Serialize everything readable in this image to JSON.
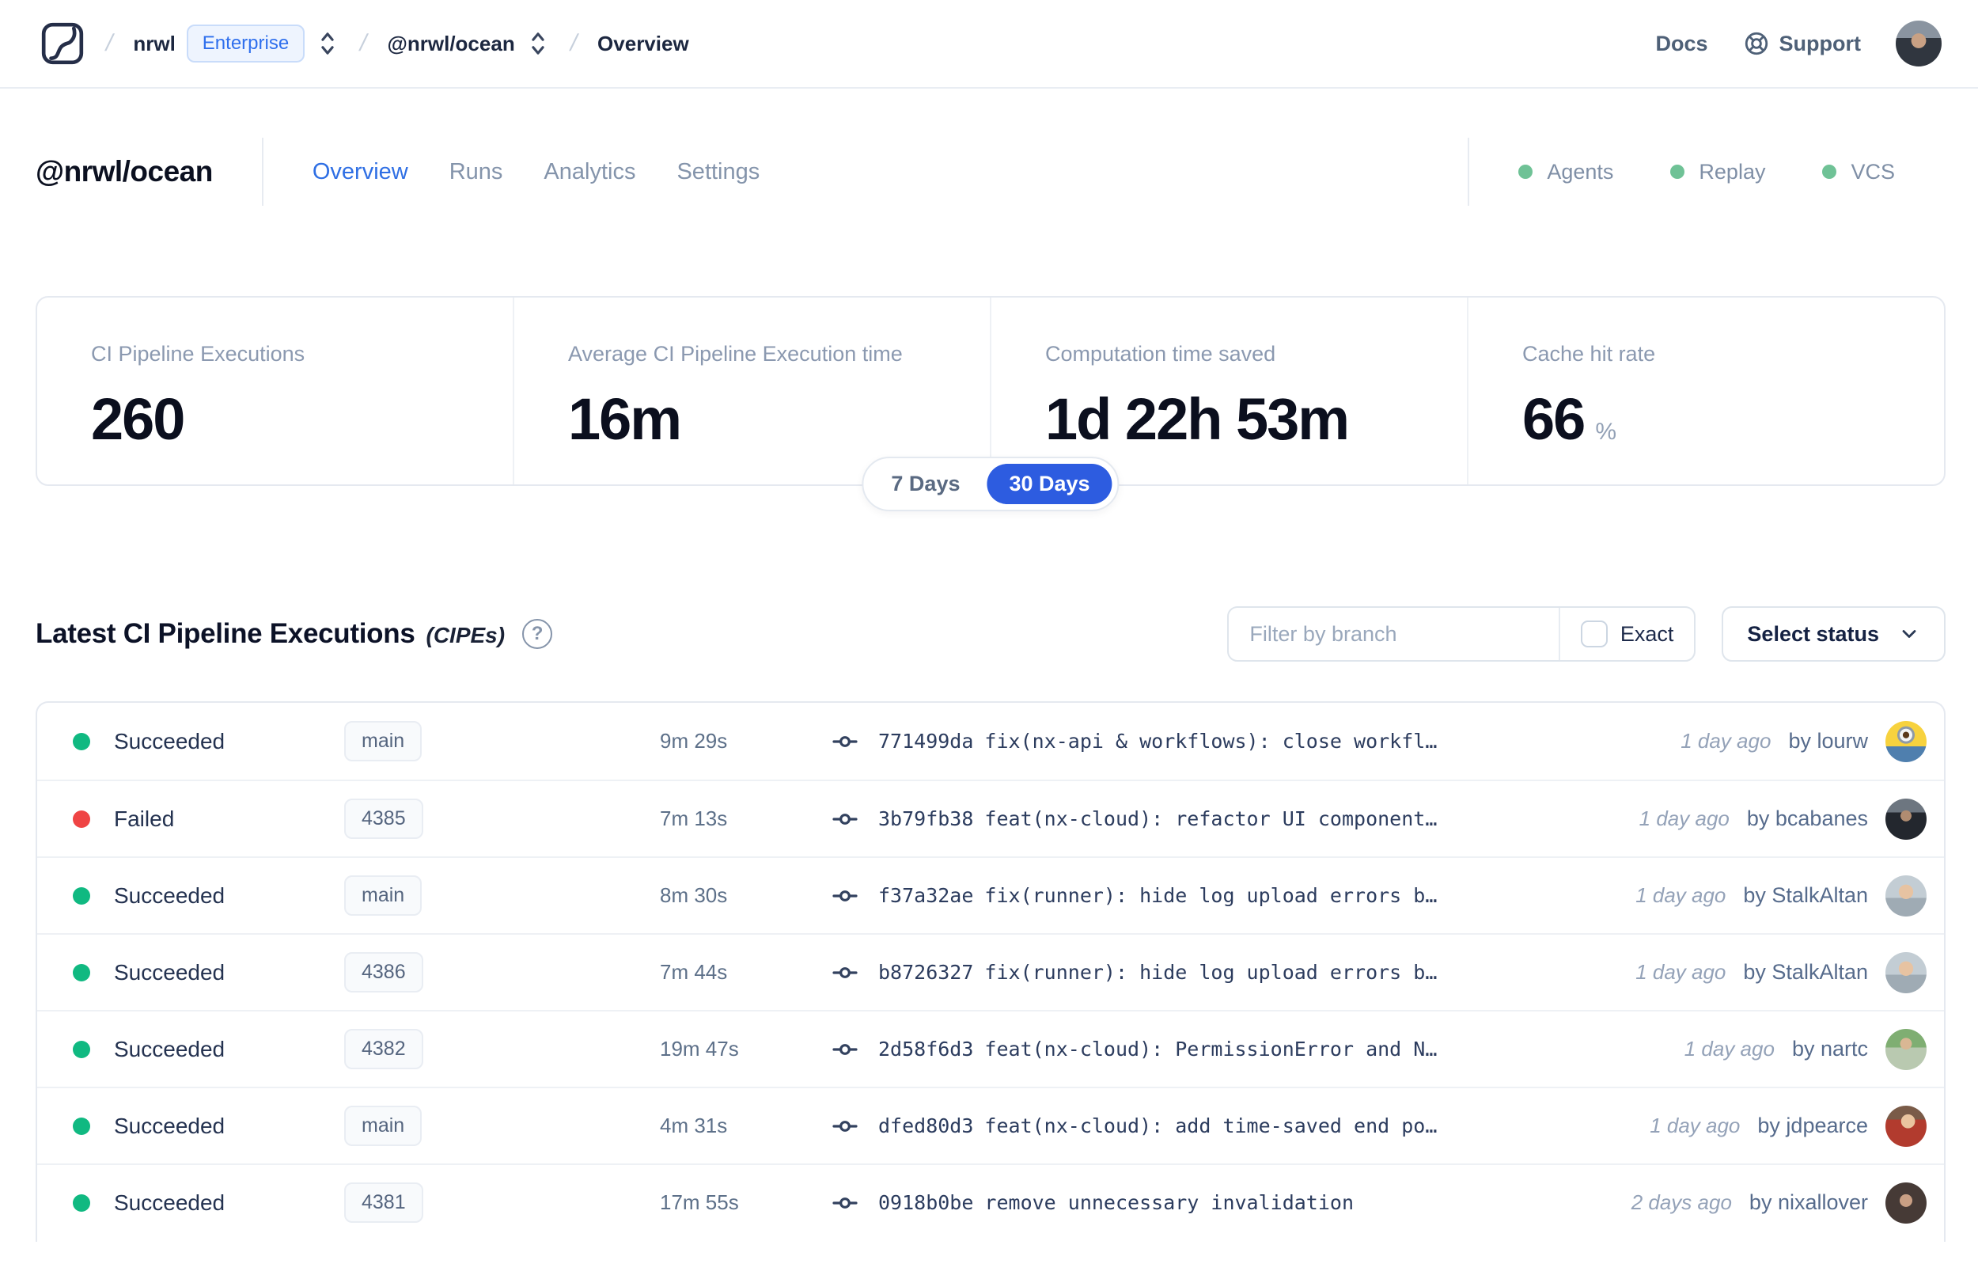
{
  "header": {
    "breadcrumb": {
      "separator": "/",
      "org": "nrwl",
      "org_badge": "Enterprise",
      "workspace": "@nrwl/ocean",
      "page": "Overview"
    },
    "nav": {
      "docs": "Docs",
      "support": "Support"
    }
  },
  "workspace": {
    "title": "@nrwl/ocean",
    "tabs": [
      {
        "label": "Overview",
        "active": true
      },
      {
        "label": "Runs",
        "active": false
      },
      {
        "label": "Analytics",
        "active": false
      },
      {
        "label": "Settings",
        "active": false
      }
    ],
    "env_badges": [
      {
        "label": "Agents"
      },
      {
        "label": "Replay"
      },
      {
        "label": "VCS"
      }
    ]
  },
  "stats": {
    "cards": [
      {
        "label": "CI Pipeline Executions",
        "value": "260",
        "suffix": ""
      },
      {
        "label": "Average CI Pipeline Execution time",
        "value": "16m",
        "suffix": ""
      },
      {
        "label": "Computation time saved",
        "value": "1d 22h 53m",
        "suffix": ""
      },
      {
        "label": "Cache hit rate",
        "value": "66",
        "suffix": "%"
      }
    ]
  },
  "range_toggle": {
    "options": [
      "7 Days",
      "30 Days"
    ],
    "selected": "30 Days"
  },
  "cipe_section": {
    "title": "Latest CI Pipeline Executions",
    "title_suffix": "(CIPEs)",
    "help_glyph": "?",
    "filter_placeholder": "Filter by branch",
    "exact_label": "Exact",
    "status_select_label": "Select status"
  },
  "table": {
    "rows": [
      {
        "status": "Succeeded",
        "branch": "main",
        "duration": "9m 29s",
        "commit_hash": "771499da",
        "commit_message": "fix(nx-api & workflows): close workfl…",
        "time_ago": "1 day ago",
        "author": "by lourw",
        "avatar": "lourw"
      },
      {
        "status": "Failed",
        "branch": "4385",
        "duration": "7m 13s",
        "commit_hash": "3b79fb38",
        "commit_message": "feat(nx-cloud): refactor UI component…",
        "time_ago": "1 day ago",
        "author": "by bcabanes",
        "avatar": "bcabanes"
      },
      {
        "status": "Succeeded",
        "branch": "main",
        "duration": "8m 30s",
        "commit_hash": "f37a32ae",
        "commit_message": "fix(runner): hide log upload errors b…",
        "time_ago": "1 day ago",
        "author": "by StalkAltan",
        "avatar": "StalkAltan"
      },
      {
        "status": "Succeeded",
        "branch": "4386",
        "duration": "7m 44s",
        "commit_hash": "b8726327",
        "commit_message": "fix(runner): hide log upload errors b…",
        "time_ago": "1 day ago",
        "author": "by StalkAltan",
        "avatar": "StalkAltan"
      },
      {
        "status": "Succeeded",
        "branch": "4382",
        "duration": "19m 47s",
        "commit_hash": "2d58f6d3",
        "commit_message": "feat(nx-cloud): PermissionError and N…",
        "time_ago": "1 day ago",
        "author": "by nartc",
        "avatar": "nartc"
      },
      {
        "status": "Succeeded",
        "branch": "main",
        "duration": "4m 31s",
        "commit_hash": "dfed80d3",
        "commit_message": "feat(nx-cloud): add time-saved end po…",
        "time_ago": "1 day ago",
        "author": "by jdpearce",
        "avatar": "jdpearce"
      },
      {
        "status": "Succeeded",
        "branch": "4381",
        "duration": "17m 55s",
        "commit_hash": "0918b0be",
        "commit_message": "remove unnecessary invalidation",
        "time_ago": "2 days ago",
        "author": "by nixallover",
        "avatar": "nixallover"
      }
    ]
  },
  "colors": {
    "accent_blue": "#2d5ce0",
    "active_tab_blue": "#2f6fe4",
    "enterprise_badge_blue": "#2f6fed",
    "status_succeeded_green": "#10b981",
    "status_failed_red": "#ef4444",
    "env_badge_green": "#6fc296",
    "border_gray": "#e5e9f0"
  }
}
